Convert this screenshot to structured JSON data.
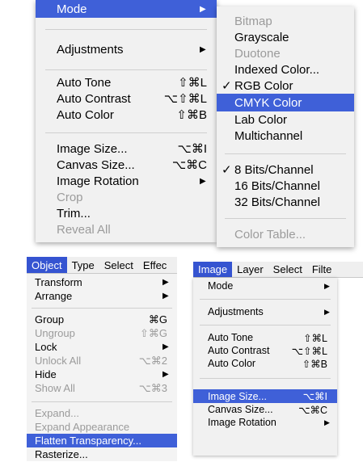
{
  "main_menu": {
    "mode": "Mode",
    "adjustments": "Adjustments",
    "auto_tone": "Auto Tone",
    "auto_tone_sc": "⇧⌘L",
    "auto_contrast": "Auto Contrast",
    "auto_contrast_sc": "⌥⇧⌘L",
    "auto_color": "Auto Color",
    "auto_color_sc": "⇧⌘B",
    "image_size": "Image Size...",
    "image_size_sc": "⌥⌘I",
    "canvas_size": "Canvas Size...",
    "canvas_size_sc": "⌥⌘C",
    "image_rotation": "Image Rotation",
    "crop": "Crop",
    "trim": "Trim...",
    "reveal_all": "Reveal All"
  },
  "mode_submenu": {
    "bitmap": "Bitmap",
    "grayscale": "Grayscale",
    "duotone": "Duotone",
    "indexed": "Indexed Color...",
    "rgb": "RGB Color",
    "cmyk": "CMYK Color",
    "lab": "Lab Color",
    "multichannel": "Multichannel",
    "bits8": "8 Bits/Channel",
    "bits16": "16 Bits/Channel",
    "bits32": "32 Bits/Channel",
    "color_table": "Color Table..."
  },
  "object_menubar": [
    "Object",
    "Type",
    "Select",
    "Effec"
  ],
  "object_menu": {
    "transform": "Transform",
    "arrange": "Arrange",
    "group": "Group",
    "group_sc": "⌘G",
    "ungroup": "Ungroup",
    "ungroup_sc": "⇧⌘G",
    "lock": "Lock",
    "unlock_all": "Unlock All",
    "unlock_all_sc": "⌥⌘2",
    "hide": "Hide",
    "show_all": "Show All",
    "show_all_sc": "⌥⌘3",
    "expand": "Expand...",
    "expand_appearance": "Expand Appearance",
    "flatten": "Flatten Transparency...",
    "rasterize": "Rasterize..."
  },
  "image_menubar": [
    "Image",
    "Layer",
    "Select",
    "Filte"
  ],
  "image_menu": {
    "mode": "Mode",
    "adjustments": "Adjustments",
    "auto_tone": "Auto Tone",
    "auto_tone_sc": "⇧⌘L",
    "auto_contrast": "Auto Contrast",
    "auto_contrast_sc": "⌥⇧⌘L",
    "auto_color": "Auto Color",
    "auto_color_sc": "⇧⌘B",
    "image_size": "Image Size...",
    "image_size_sc": "⌥⌘I",
    "canvas_size": "Canvas Size...",
    "canvas_size_sc": "⌥⌘C",
    "image_rotation": "Image Rotation"
  },
  "glyphs": {
    "arrow": "▶",
    "check": "✓"
  },
  "colors": {
    "highlight": "#3f60d8",
    "menubar_active": "#3554d1",
    "disabled": "#9b9b9b"
  }
}
